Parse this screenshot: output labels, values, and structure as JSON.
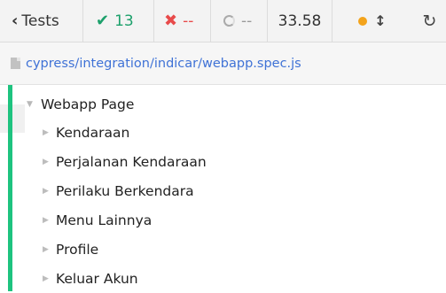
{
  "topbar": {
    "back_label": "Tests",
    "passed_count": "13",
    "failed_count": "--",
    "pending_count": "--",
    "duration": "33.58",
    "status_color": "#f3a31b"
  },
  "filebar": {
    "path": "cypress/integration/indicar/webapp.spec.js"
  },
  "suite": {
    "title": "Webapp Page",
    "items": [
      {
        "label": "Kendaraan"
      },
      {
        "label": "Perjalanan Kendaraan"
      },
      {
        "label": "Perilaku Berkendara"
      },
      {
        "label": "Menu Lainnya"
      },
      {
        "label": "Profile"
      },
      {
        "label": "Keluar Akun"
      }
    ]
  },
  "colors": {
    "passed": "#1ca06b",
    "failed": "#e84a4a",
    "link": "#3f72d6",
    "suite_bar": "#1ec37f"
  }
}
